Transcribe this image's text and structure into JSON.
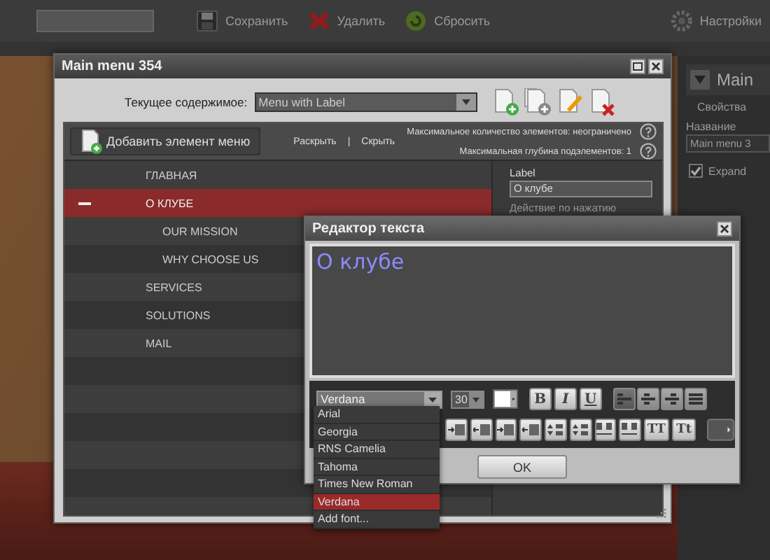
{
  "app_toolbar": {
    "buttons": [
      {
        "label": "Сохранить",
        "kind": "save"
      },
      {
        "label": "Удалить",
        "kind": "delete"
      },
      {
        "label": "Сбросить",
        "kind": "reset"
      },
      {
        "label": "Настройки",
        "kind": "settings"
      }
    ]
  },
  "side_panel": {
    "title": "Main",
    "tab": "Свойства",
    "field_label": "Название",
    "field_value": "Main menu 3",
    "checkbox": {
      "label": "Expand",
      "checked": true
    }
  },
  "main_window": {
    "title": "Main menu 354",
    "content_label": "Текущее содержимое:",
    "content_value": "Menu with Label",
    "add_button": "Добавить элемент меню",
    "expand_link": "Раскрыть",
    "separator": "|",
    "collapse_link": "Скрыть",
    "limits": [
      "Максимальное количество элементов: неограничено",
      "Максимальная глубина подэлементов: 1"
    ],
    "menu_items": [
      {
        "label": "ГЛАВНАЯ",
        "selected": false
      },
      {
        "label": "О КЛУБЕ",
        "selected": true,
        "expanded": true,
        "children": [
          {
            "label": "OUR MISSION",
            "selected": false
          },
          {
            "label": "WHY CHOOSE US",
            "selected": false
          }
        ]
      },
      {
        "label": "SERVICES",
        "selected": false
      },
      {
        "label": "SOLUTIONS",
        "selected": false
      },
      {
        "label": "MAIL",
        "selected": false
      }
    ],
    "properties": {
      "label_caption": "Label",
      "label_value": "О клубе",
      "action_caption": "Действие по нажатию"
    }
  },
  "text_editor": {
    "title": "Редактор текста",
    "content": "О клубе",
    "font": "Verdana",
    "size": "30",
    "font_options": [
      {
        "label": "Arial",
        "selected": false
      },
      {
        "label": "Georgia",
        "selected": false
      },
      {
        "label": "RNS Camelia",
        "selected": false
      },
      {
        "label": "Tahoma",
        "selected": false
      },
      {
        "label": "Times New Roman",
        "selected": false
      },
      {
        "label": "Verdana",
        "selected": true
      },
      {
        "label": "Add font...",
        "selected": false
      }
    ],
    "style_buttons": [
      {
        "label": "B",
        "kind": "bold"
      },
      {
        "label": "I",
        "kind": "italic"
      },
      {
        "label": "U",
        "kind": "underline"
      }
    ],
    "align_buttons": [
      {
        "kind": "left",
        "selected": true
      },
      {
        "kind": "center",
        "selected": false
      },
      {
        "kind": "right",
        "selected": false
      },
      {
        "kind": "justify",
        "selected": false
      }
    ],
    "case_buttons": [
      "TT",
      "Tt"
    ],
    "ok": "OK"
  }
}
